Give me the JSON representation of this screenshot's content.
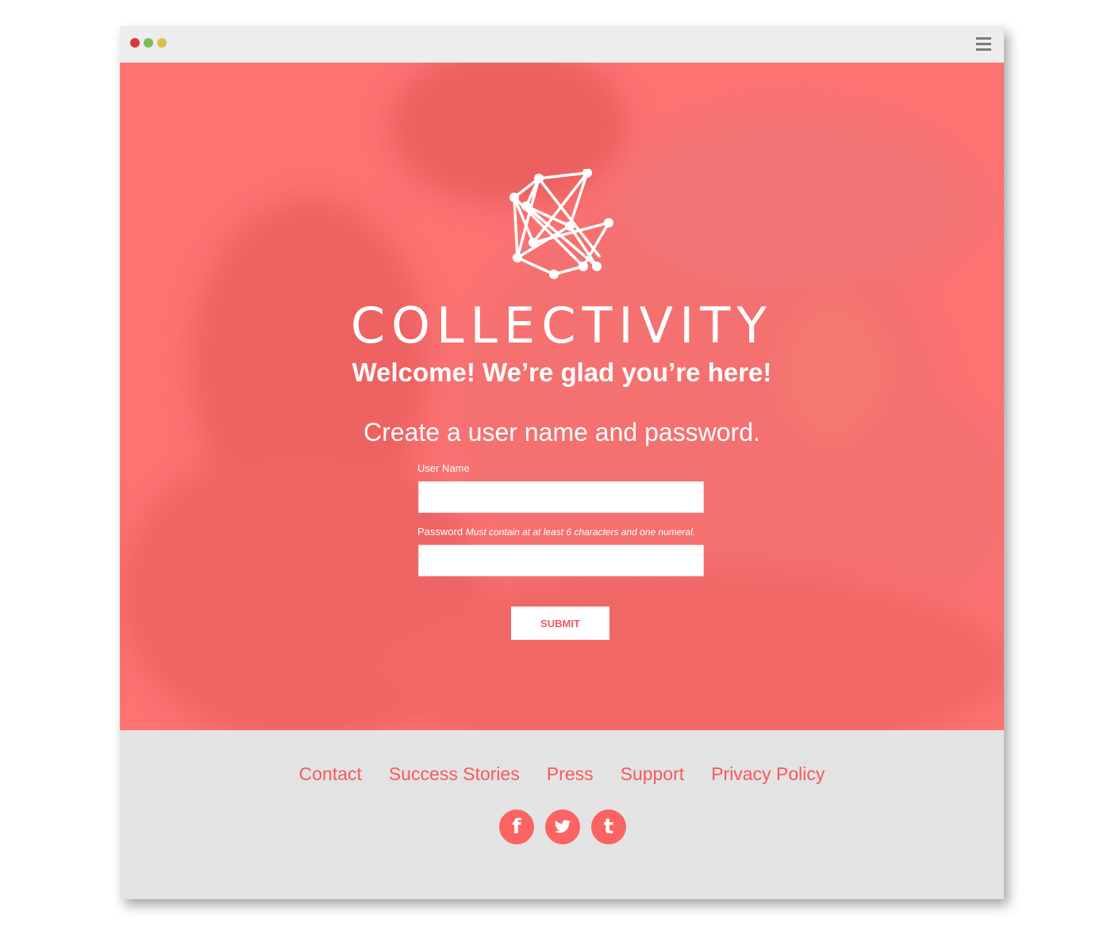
{
  "window": {
    "controls": [
      "close",
      "minimize",
      "maximize"
    ],
    "menu_icon": "hamburger-menu-icon"
  },
  "hero": {
    "logo_icon": "network-nodes-logo-icon",
    "brand": "COLLECTIVITY",
    "welcome": "Welcome! We’re glad you’re here!",
    "subtitle": "Create a user name and password.",
    "form": {
      "username_label": "User Name",
      "username_value": "",
      "password_label": "Password",
      "password_hint": "Must contain at at least 6 characters and one numeral.",
      "password_value": "",
      "submit_label": "SUBMIT"
    }
  },
  "footer": {
    "links": [
      "Contact",
      "Success Stories",
      "Press",
      "Support",
      "Privacy Policy"
    ],
    "social": [
      {
        "name": "facebook-icon",
        "glyph": "f"
      },
      {
        "name": "twitter-icon",
        "glyph": "🐦"
      },
      {
        "name": "tumblr-icon",
        "glyph": "t"
      }
    ]
  },
  "colors": {
    "accent": "#f45a5c",
    "hero_bg": "#fb7372",
    "footer_bg": "#e3e3e3"
  }
}
